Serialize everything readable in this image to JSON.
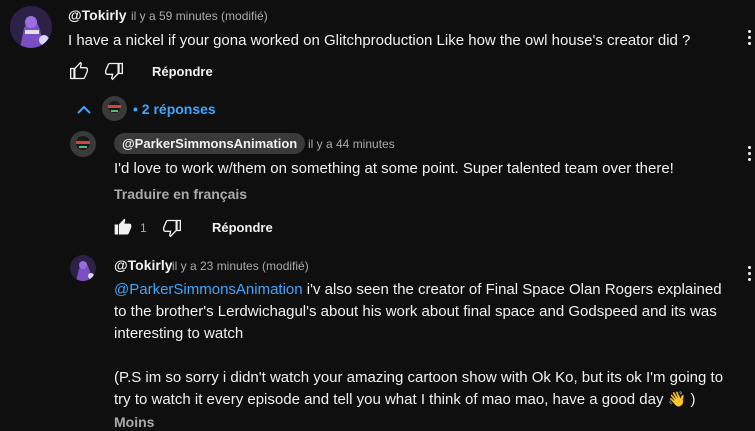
{
  "comment": {
    "author": "@Tokirly",
    "time": "il y a 59 minutes (modifié)",
    "text": "I have a nickel if your gona worked on Glitchproduction Like how the owl house's creator did ?",
    "reply_label": "Répondre",
    "replies_toggle": "2 réponses"
  },
  "replies": [
    {
      "author": "@ParkerSimmonsAnimation",
      "time": "il y a 44 minutes",
      "text": "I'd love to work w/them on something at some point. Super talented team over there!",
      "translate_label": "Traduire en français",
      "like_count": "1",
      "reply_label": "Répondre"
    },
    {
      "author": "@Tokirly",
      "time": "il y a 23 minutes (modifié)",
      "mention": "@ParkerSimmonsAnimation",
      "text_line1": " i'v also seen the creator of Final Space Olan Rogers explained",
      "text_line2": "to the brother's Lerdwichagul's about his work about final space and Godspeed and its was",
      "text_line3": "interesting to watch",
      "text_line4": "(P.S im so sorry i didn't watch your amazing cartoon show with Ok Ko, but its ok I'm going to",
      "text_line5": "try to watch it every episode and tell you what I think of mao mao, have a good day 👋 )",
      "more_label": "Moins"
    }
  ],
  "icons": {
    "like": "thumbs-up-icon",
    "dislike": "thumbs-down-icon",
    "more": "kebab-menu-icon",
    "collapse": "chevron-up-icon"
  },
  "colors": {
    "background": "#0f0f0f",
    "link": "#3ea6ff",
    "muted": "#aaaaaa"
  }
}
